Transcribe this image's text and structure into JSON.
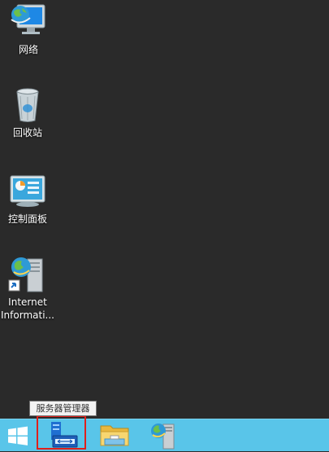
{
  "desktop": {
    "icons": [
      {
        "label": "网络",
        "icon": "network-icon"
      },
      {
        "label": "回收站",
        "icon": "recycle-bin-icon"
      },
      {
        "label": "控制面板",
        "icon": "control-panel-icon"
      },
      {
        "label": "Internet\nInformati...",
        "icon": "iis-manager-icon"
      }
    ]
  },
  "taskbar": {
    "buttons": [
      {
        "name": "start",
        "icon": "windows-logo-icon"
      },
      {
        "name": "server-manager",
        "icon": "server-manager-icon"
      },
      {
        "name": "file-explorer",
        "icon": "folder-icon"
      },
      {
        "name": "iis-manager",
        "icon": "iis-manager-icon"
      }
    ],
    "tooltip": "服务器管理器"
  },
  "colors": {
    "desktop_bg": "#2b2b2b",
    "taskbar_bg": "#59c5e9",
    "highlight": "#e0201b"
  }
}
